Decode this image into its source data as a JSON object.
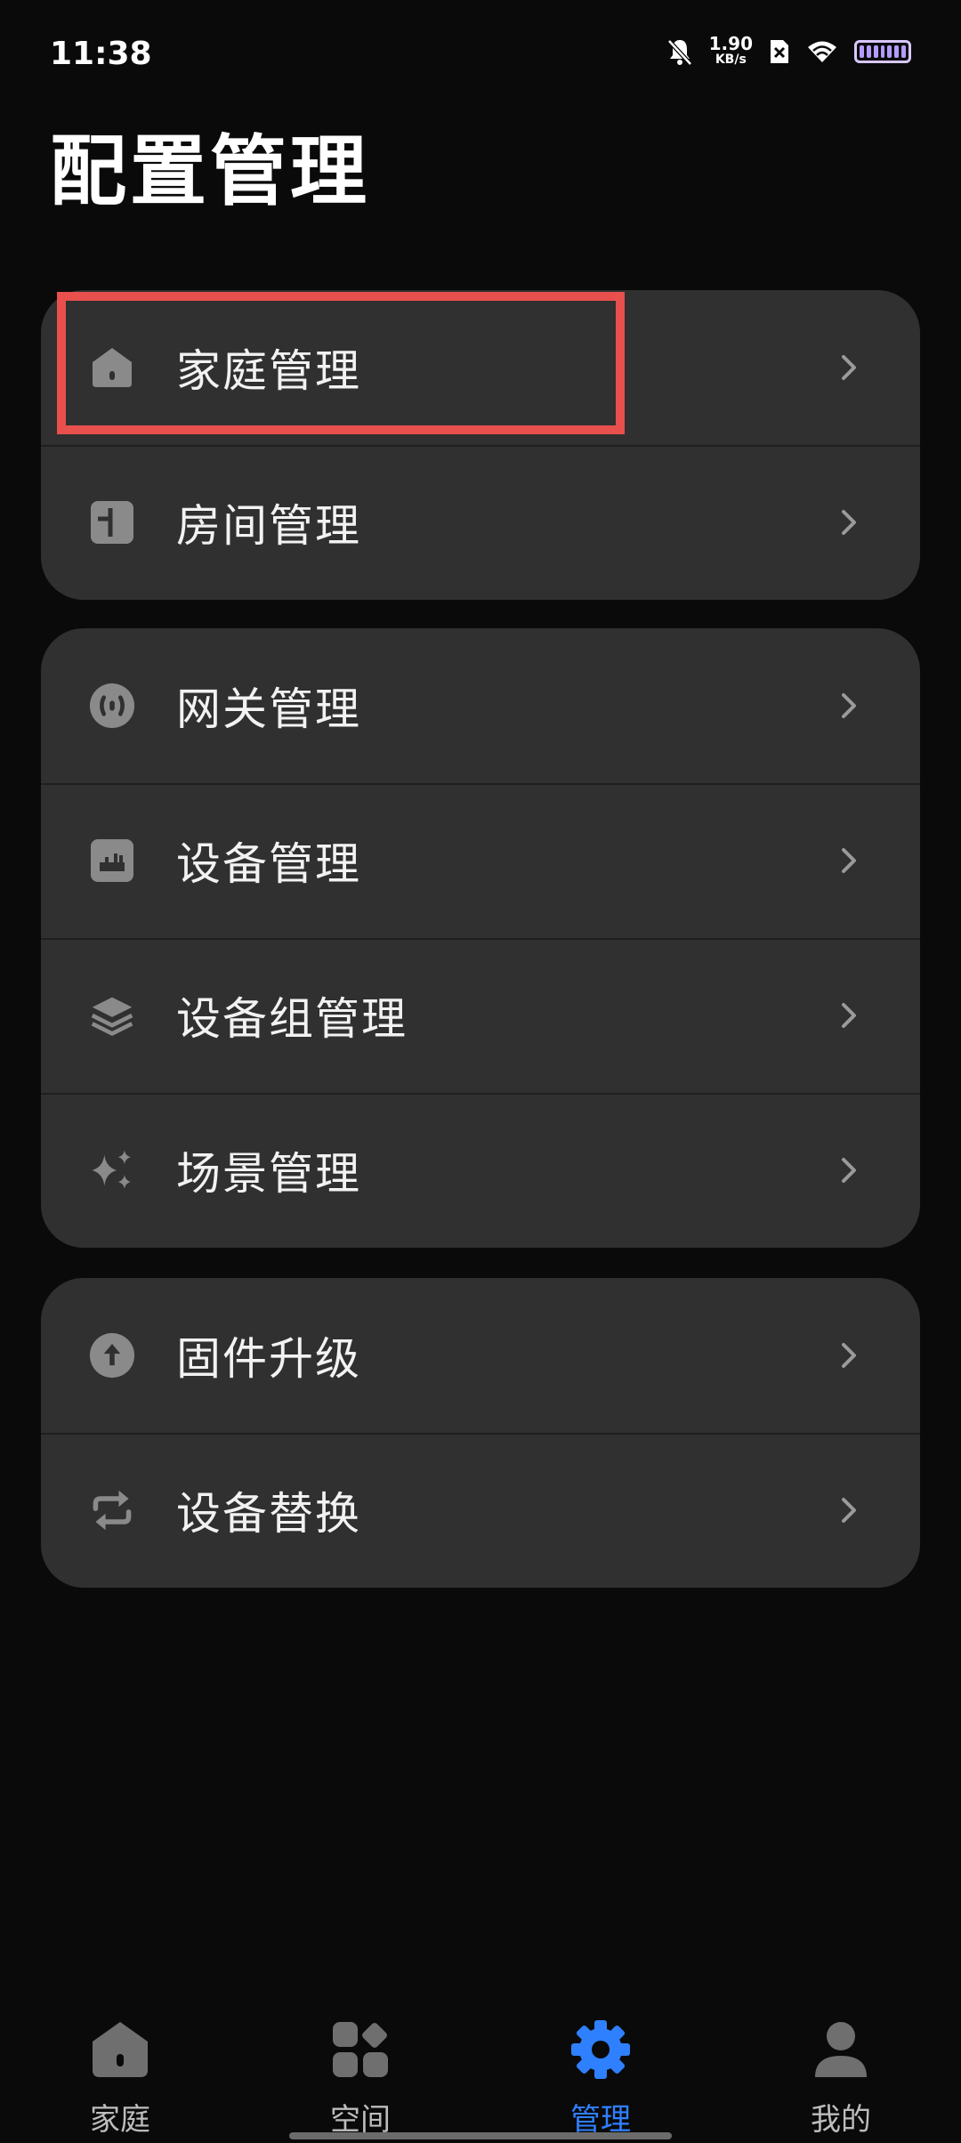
{
  "status_bar": {
    "time": "11:38",
    "net_speed_value": "1.90",
    "net_speed_unit": "KB/s",
    "icons": [
      "bell-off-icon",
      "sim-x-icon",
      "wifi-icon",
      "battery-icon"
    ]
  },
  "page": {
    "title": "配置管理"
  },
  "groups": [
    {
      "items": [
        {
          "label": "家庭管理",
          "icon": "home-icon"
        },
        {
          "label": "房间管理",
          "icon": "room-icon"
        }
      ]
    },
    {
      "items": [
        {
          "label": "网关管理",
          "icon": "gateway-icon"
        },
        {
          "label": "设备管理",
          "icon": "device-icon"
        },
        {
          "label": "设备组管理",
          "icon": "layers-icon"
        },
        {
          "label": "场景管理",
          "icon": "sparkle-icon"
        }
      ]
    },
    {
      "items": [
        {
          "label": "固件升级",
          "icon": "upload-icon"
        },
        {
          "label": "设备替换",
          "icon": "swap-icon"
        }
      ]
    }
  ],
  "tabs": [
    {
      "label": "家庭",
      "icon": "home-icon",
      "active": false
    },
    {
      "label": "空间",
      "icon": "grid-icon",
      "active": false
    },
    {
      "label": "管理",
      "icon": "gear-icon",
      "active": true
    },
    {
      "label": "我的",
      "icon": "user-icon",
      "active": false
    }
  ],
  "colors": {
    "background": "#0a0a0a",
    "card": "#303030",
    "accent": "#2f80ff",
    "highlight_box": "#e8504d",
    "icon_gray": "#8a8a8a"
  }
}
